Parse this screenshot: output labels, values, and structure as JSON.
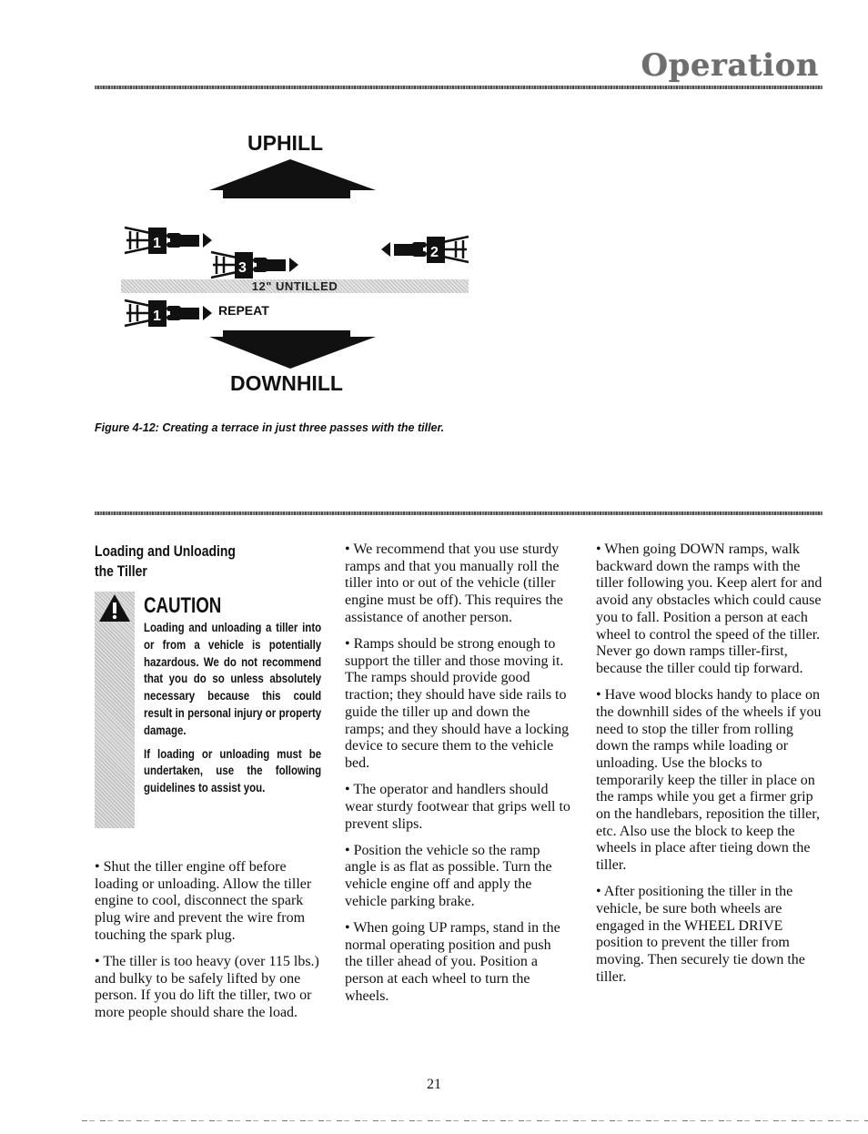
{
  "header": {
    "title": "Operation"
  },
  "figure": {
    "uphill_label": "UPHILL",
    "downhill_label": "DOWNHILL",
    "untilled_label": "12\" UNTILLED",
    "repeat_label": "REPEAT",
    "pass_numbers": [
      "1",
      "3",
      "2",
      "1"
    ],
    "caption": "Figure 4-12: Creating a terrace in just three passes with the tiller."
  },
  "section": {
    "heading_line1": "Loading and Unloading",
    "heading_line2": "the Tiller",
    "caution": {
      "icon": "warning-triangle-icon",
      "title": "CAUTION",
      "paragraphs": [
        "Loading and unloading a tiller into or from a vehicle is potentially hazardous. We do not recommend that you do so unless absolutely necessary because this could result in personal injury or property damage.",
        "If loading or unloading must be undertaken, use the following guidelines to assist you."
      ]
    },
    "column1": [
      "•  Shut the tiller engine off before loading or unloading. Allow the tiller engine to cool, disconnect the spark plug wire and prevent the wire from touching the spark plug.",
      "•  The tiller is too heavy (over 115 lbs.) and bulky to be safely lifted by one person. If you do lift the tiller, two or more people should share the load."
    ],
    "column2": [
      "•  We recommend that you use sturdy ramps and that you manually roll the tiller into or out of the vehicle (tiller engine must be off). This requires the assistance of another person.",
      "•  Ramps should be strong enough to support the tiller and those moving it. The ramps should provide good traction; they should have side rails to guide the tiller up and down the ramps; and they should have a locking device to secure them to the vehicle bed.",
      "•  The operator and handlers should wear sturdy footwear that grips well to prevent slips.",
      "•  Position the vehicle so the ramp angle is as flat as possible. Turn the vehicle engine off and apply the vehicle parking brake.",
      "•  When going UP ramps, stand in the normal operating position and push the tiller ahead of you. Position a person at each wheel to turn the wheels."
    ],
    "column3": [
      "•  When going DOWN ramps, walk backward down the ramps with the tiller following you. Keep alert for and avoid any obstacles which could cause you to fall. Position a person at each wheel to control the speed of the tiller. Never go down ramps tiller-first, because the tiller could tip forward.",
      "•  Have wood blocks handy to place on the downhill sides of the wheels if you need to stop the tiller from rolling down the ramps while loading or unloading. Use the blocks to temporarily keep the tiller in place on the ramps while you get a firmer grip on the handlebars, reposition the tiller, etc. Also use the block to keep the wheels in place after tieing down the tiller.",
      "•  After positioning the tiller in the vehicle, be sure both wheels are engaged in the WHEEL DRIVE position to prevent the tiller from moving. Then securely tie down the tiller."
    ]
  },
  "footer": {
    "page_number": "21"
  }
}
